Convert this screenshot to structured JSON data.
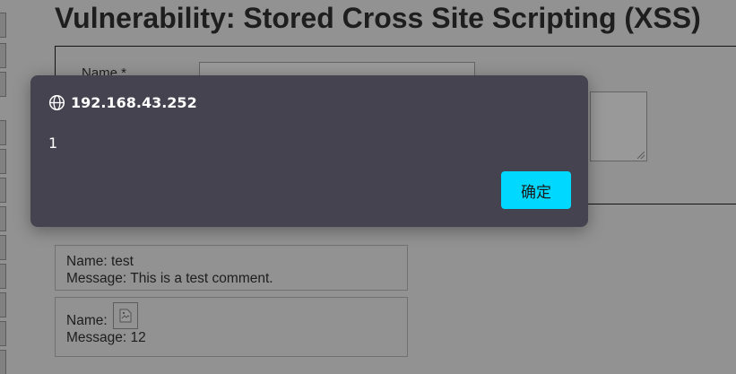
{
  "page": {
    "title": "Vulnerability: Stored Cross Site Scripting (XSS)"
  },
  "form": {
    "name_label": "Name *",
    "name_value": ""
  },
  "comments": [
    {
      "name_line": "Name: test",
      "message_line": "Message: This is a test comment."
    },
    {
      "name_line": "Name:",
      "message_line": "Message: 12"
    }
  ],
  "dialog": {
    "origin": "192.168.43.252",
    "message": "1",
    "ok_label": "确定",
    "accent_color": "#00d8ff",
    "icon": "globe-icon"
  }
}
